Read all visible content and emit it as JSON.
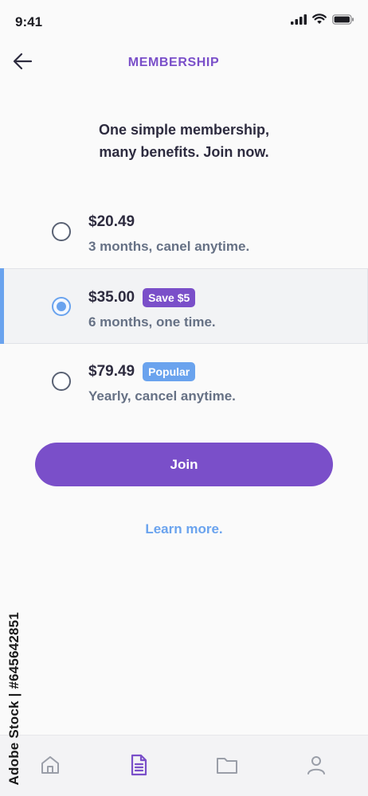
{
  "status_bar": {
    "time": "9:41",
    "icons": [
      "signal-icon",
      "wifi-icon",
      "battery-icon"
    ]
  },
  "header": {
    "back_icon": "arrow-left-icon",
    "title": "MEMBERSHIP"
  },
  "headline": {
    "line1": "One simple membership,",
    "line2": "many benefits. Join now."
  },
  "plans": [
    {
      "price": "$20.49",
      "badge": "",
      "description": "3 months, canel anytime.",
      "selected": false
    },
    {
      "price": "$35.00",
      "badge": "Save $5",
      "description": "6 months, one time.",
      "selected": true
    },
    {
      "price": "$79.49",
      "badge": "Popular",
      "description": "Yearly, cancel anytime.",
      "selected": false
    }
  ],
  "join_button": {
    "label": "Join"
  },
  "learn_more": {
    "label": "Learn more."
  },
  "tab_bar": {
    "tabs": [
      {
        "icon": "home-icon",
        "active": false
      },
      {
        "icon": "document-icon",
        "active": true
      },
      {
        "icon": "folder-icon",
        "active": false
      },
      {
        "icon": "user-icon",
        "active": false
      }
    ]
  },
  "watermark": {
    "text": "Adobe Stock | #645642851"
  },
  "colors": {
    "accent_purple": "#7a4fc9",
    "accent_blue": "#6aa3ee",
    "text_dark": "#2d2b3f",
    "text_muted": "#667185",
    "background": "#fafafa"
  }
}
